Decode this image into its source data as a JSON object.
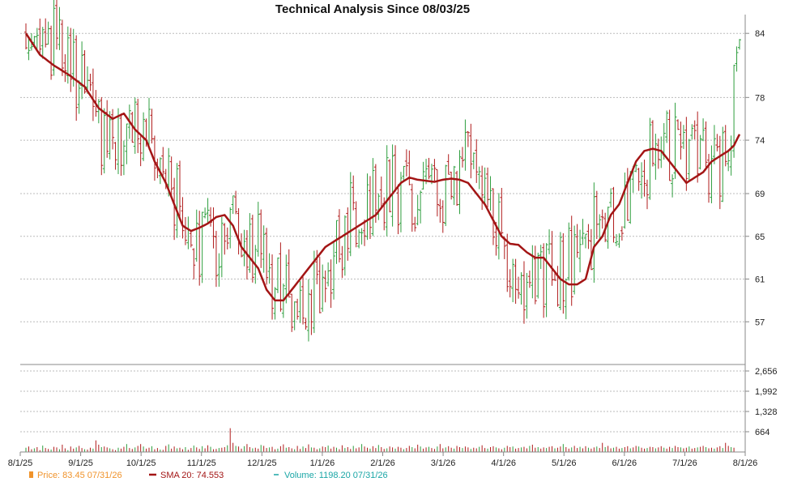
{
  "chart_data": {
    "type": "line",
    "title": "Technical Analysis Since 08/03/25",
    "x_tick_labels": [
      "8/1/25",
      "9/1/25",
      "10/1/25",
      "11/1/25",
      "12/1/25",
      "1/1/26",
      "2/1/26",
      "3/1/26",
      "4/1/26",
      "5/1/26",
      "6/1/26",
      "7/1/26",
      "8/1/26"
    ],
    "price_axis": {
      "ticks": [
        "57",
        "61",
        "65",
        "69",
        "74",
        "78",
        "84"
      ],
      "ylim": [
        53,
        85
      ]
    },
    "volume_axis": {
      "ticks": [
        "664",
        "1,328",
        "1,992",
        "2,656"
      ],
      "ylim": [
        0,
        2656
      ]
    },
    "grid": true,
    "legend_position": "bottom-left",
    "colors": {
      "up": "#2e9e3e",
      "down": "#b01c1c",
      "sma": "#a31515",
      "volume_legend": "#1aa6a6",
      "price_legend": "#f0932b",
      "grid": "#bbbbbb"
    },
    "legend": {
      "price": "Price: 83.45  07/31/26",
      "sma": "SMA 20: 74.553",
      "volume": "Volume: 1198.20  07/31/26"
    },
    "series": [
      {
        "name": "SMA 20",
        "points": [
          [
            0,
            84
          ],
          [
            5,
            82
          ],
          [
            10,
            81
          ],
          [
            16,
            80
          ],
          [
            21,
            79
          ],
          [
            26,
            77
          ],
          [
            31,
            76
          ],
          [
            35,
            76.5
          ],
          [
            39,
            75
          ],
          [
            43,
            74
          ],
          [
            46,
            72
          ],
          [
            50,
            70
          ],
          [
            53,
            68
          ],
          [
            56,
            66
          ],
          [
            59,
            65.5
          ],
          [
            62,
            65.8
          ],
          [
            65,
            66.2
          ],
          [
            68,
            66.8
          ],
          [
            71,
            67
          ],
          [
            74,
            66
          ],
          [
            77,
            64
          ],
          [
            80,
            63
          ],
          [
            83,
            62
          ],
          [
            86,
            60
          ],
          [
            89,
            59
          ],
          [
            92,
            59
          ],
          [
            95,
            60
          ],
          [
            98,
            61
          ],
          [
            101,
            62
          ],
          [
            104,
            63
          ],
          [
            107,
            64
          ],
          [
            110,
            64.5
          ],
          [
            113,
            65
          ],
          [
            116,
            65.5
          ],
          [
            119,
            66
          ],
          [
            122,
            66.5
          ],
          [
            125,
            67
          ],
          [
            128,
            68
          ],
          [
            131,
            69
          ],
          [
            134,
            70
          ],
          [
            137,
            70.5
          ],
          [
            140,
            70.3
          ],
          [
            143,
            70.2
          ],
          [
            146,
            70.1
          ],
          [
            149,
            70.3
          ],
          [
            152,
            70.4
          ],
          [
            155,
            70.3
          ],
          [
            158,
            70
          ],
          [
            161,
            69
          ],
          [
            164,
            68
          ],
          [
            167,
            66.5
          ],
          [
            170,
            65
          ],
          [
            173,
            64.3
          ],
          [
            176,
            64.2
          ],
          [
            179,
            63.5
          ],
          [
            182,
            63
          ],
          [
            185,
            63
          ],
          [
            188,
            62
          ],
          [
            191,
            61
          ],
          [
            194,
            60.5
          ],
          [
            197,
            60.5
          ],
          [
            200,
            61
          ],
          [
            203,
            64
          ],
          [
            206,
            65
          ],
          [
            209,
            67
          ],
          [
            212,
            68
          ],
          [
            215,
            70
          ],
          [
            218,
            72
          ],
          [
            221,
            73
          ],
          [
            224,
            73.2
          ],
          [
            227,
            73
          ],
          [
            230,
            72
          ],
          [
            233,
            71
          ],
          [
            236,
            70
          ],
          [
            239,
            70.5
          ],
          [
            242,
            71
          ],
          [
            245,
            72
          ],
          [
            248,
            72.5
          ],
          [
            251,
            73
          ],
          [
            253,
            73.5
          ],
          [
            255,
            74.553
          ]
        ]
      }
    ],
    "volume_values": [
      140,
      180,
      90,
      120,
      160,
      60,
      210,
      130,
      100,
      80,
      170,
      150,
      90,
      240,
      120,
      60,
      180,
      110,
      150,
      200,
      130,
      90,
      80,
      140,
      110,
      380,
      240,
      160,
      180,
      150,
      120,
      90,
      60,
      140,
      110,
      170,
      260,
      130,
      100,
      150,
      200,
      260,
      180,
      110,
      140,
      190,
      90,
      130,
      80,
      70,
      200,
      250,
      110,
      180,
      120,
      140,
      90,
      160,
      70,
      130,
      210,
      150,
      100,
      190,
      120,
      220,
      170,
      90,
      100,
      130,
      140,
      160,
      220,
      780,
      300,
      200,
      180,
      110,
      190,
      260,
      160,
      120,
      140,
      110,
      230,
      200,
      130,
      150,
      170,
      90,
      110,
      190,
      250,
      140,
      160,
      120,
      90,
      200,
      100,
      180,
      130,
      250,
      150,
      140,
      90,
      120,
      180,
      160,
      210,
      110,
      170,
      140,
      90,
      220,
      130,
      160,
      100,
      200,
      120,
      150,
      260,
      180,
      140,
      110,
      190,
      130,
      230,
      160,
      100,
      120,
      180,
      150,
      110,
      170,
      140,
      90,
      130,
      200,
      160,
      120,
      240,
      180,
      110,
      150,
      170,
      130,
      100,
      180,
      260,
      120,
      150,
      190,
      140,
      110,
      200,
      160,
      130,
      180,
      150,
      100,
      140,
      120,
      170,
      220,
      130,
      110,
      160,
      190,
      150,
      120,
      90,
      140,
      200,
      160,
      180,
      110,
      130,
      150,
      170,
      120,
      200,
      240,
      140,
      160,
      110,
      150,
      130,
      170,
      190,
      120,
      140,
      180,
      260,
      160,
      110,
      150,
      200,
      130,
      170,
      120,
      190,
      140,
      110,
      150,
      180,
      130,
      300,
      160,
      200,
      120,
      140,
      170,
      110,
      130,
      160,
      190,
      120,
      150,
      200,
      180,
      140,
      110,
      130,
      170,
      160,
      120,
      150,
      190,
      140,
      110,
      170,
      130,
      200,
      160,
      150,
      120,
      140,
      180,
      110,
      130,
      150,
      170,
      200,
      160,
      120,
      140,
      110,
      150,
      190,
      130,
      300,
      200,
      160,
      140
    ]
  }
}
